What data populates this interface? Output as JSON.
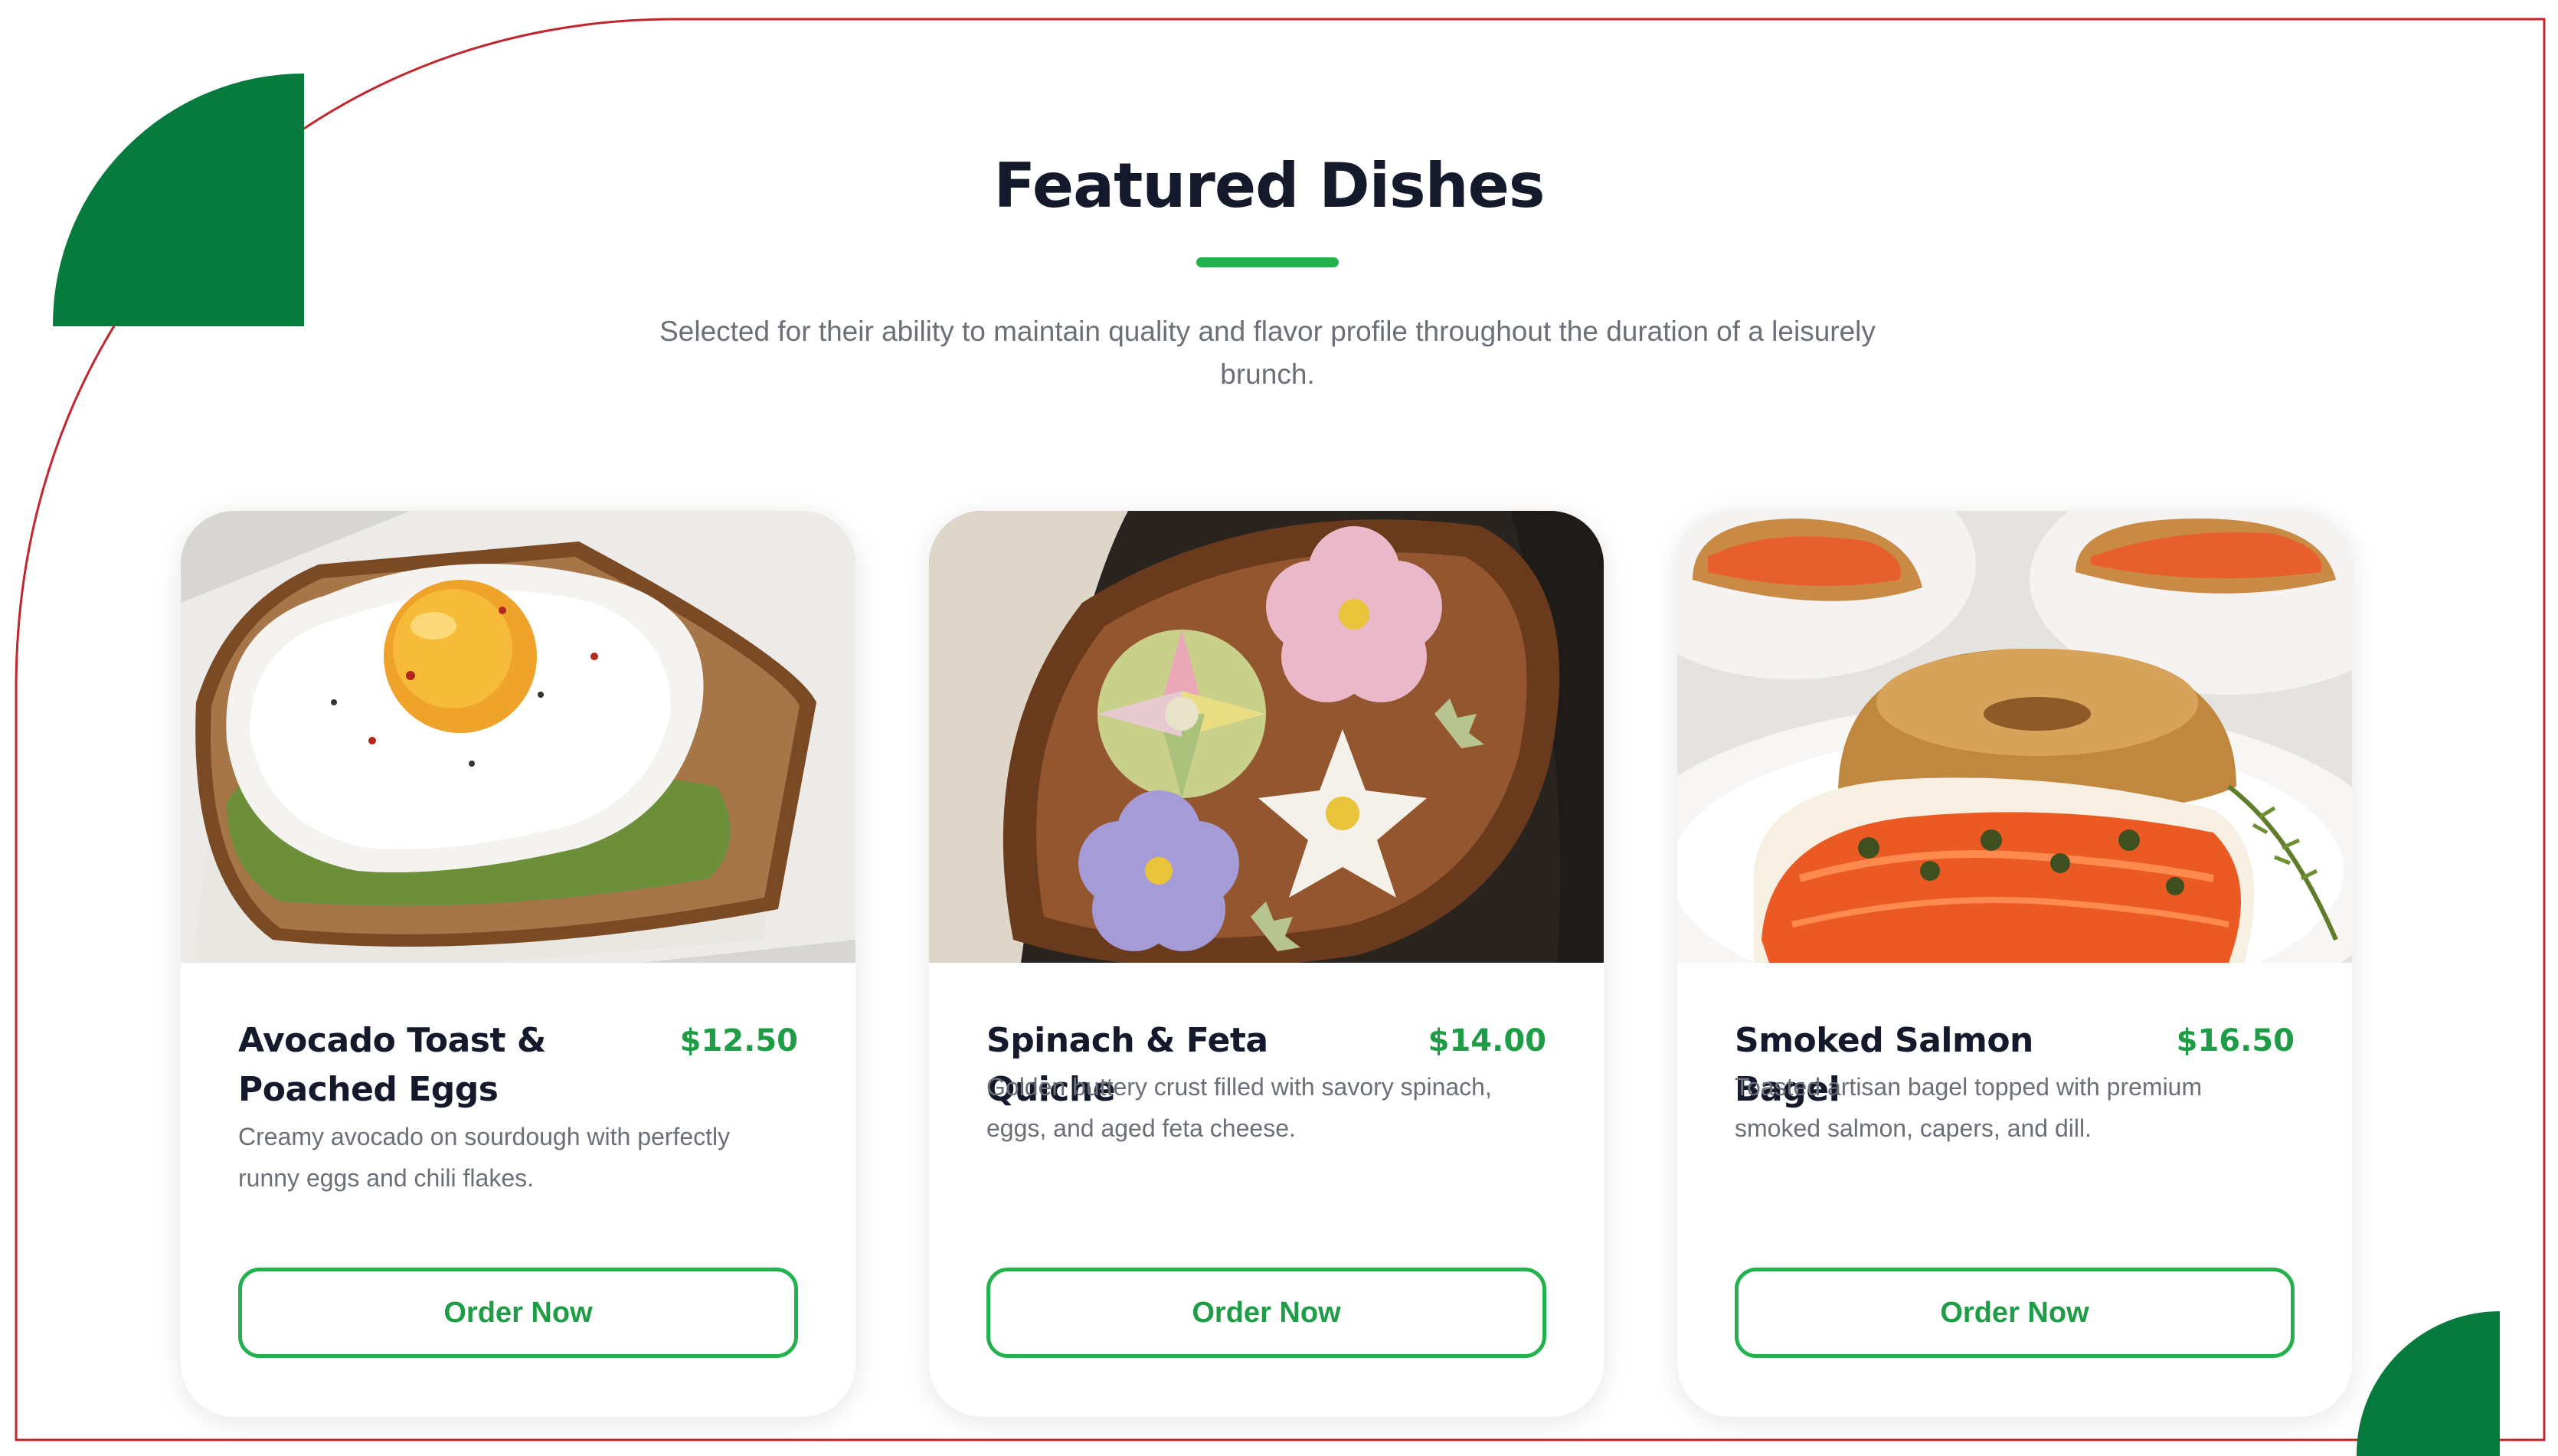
{
  "section": {
    "title": "Featured Dishes",
    "subtitle": "Selected for their ability to maintain quality and flavor profile throughout the duration of a leisurely brunch."
  },
  "theme": {
    "accent": "#22b14c",
    "deco_green": "#077a3e",
    "frame_red": "#c0262d",
    "title_color": "#141a2b"
  },
  "dishes": [
    {
      "name": "Avocado Toast & Poached Eggs",
      "price": "$12.50",
      "description": "Creamy avocado on sourdough with perfectly runny eggs and chili flakes.",
      "button_label": "Order Now",
      "image": "fried-egg-on-avocado-toast"
    },
    {
      "name": "Spinach & Feta Quiche",
      "price": "$14.00",
      "description": "Golden buttery crust filled with savory spinach, eggs, and aged feta cheese.",
      "button_label": "Order Now",
      "image": "flower-shaped-sweets-on-wooden-plate"
    },
    {
      "name": "Smoked Salmon Bagel",
      "price": "$16.50",
      "description": "Toasted artisan bagel topped with premium smoked salmon, capers, and dill.",
      "button_label": "Order Now",
      "image": "sesame-bagel-with-smoked-salmon"
    }
  ]
}
